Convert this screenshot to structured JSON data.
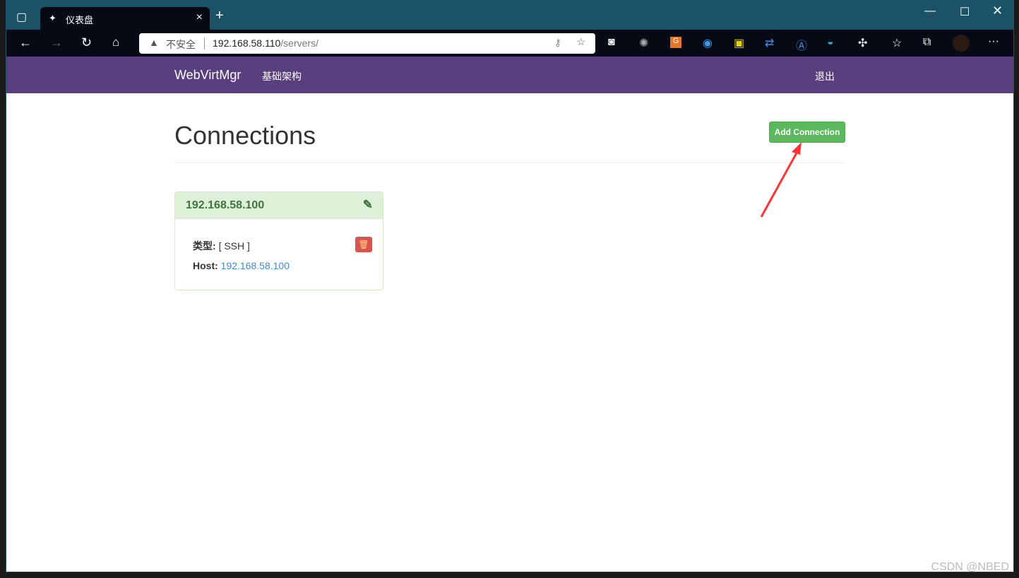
{
  "browser": {
    "tab_title": "仪表盘",
    "security_label": "不安全",
    "url_host": "192.168.58.110",
    "url_path": "/servers/",
    "extensions": [
      "copilot-icon",
      "palm-icon",
      "google-translate-icon",
      "pointer-icon",
      "terminal-icon",
      "repeat-icon",
      "read-aloud-icon",
      "bowl-icon",
      "extensions-icon",
      "favorites-icon",
      "collections-icon",
      "profile-avatar",
      "more-icon"
    ]
  },
  "navbar": {
    "brand": "WebVirtMgr",
    "link": "基础架构",
    "logout": "退出",
    "color": "#583f7e"
  },
  "main": {
    "title": "Connections",
    "add_button": "Add Connection",
    "connections": [
      {
        "name": "192.168.58.100",
        "type_label": "类型:",
        "type_value": "[ SSH ]",
        "host_label": "Host:",
        "host_value": "192.168.58.100"
      }
    ]
  },
  "watermark": "CSDN @NBED"
}
